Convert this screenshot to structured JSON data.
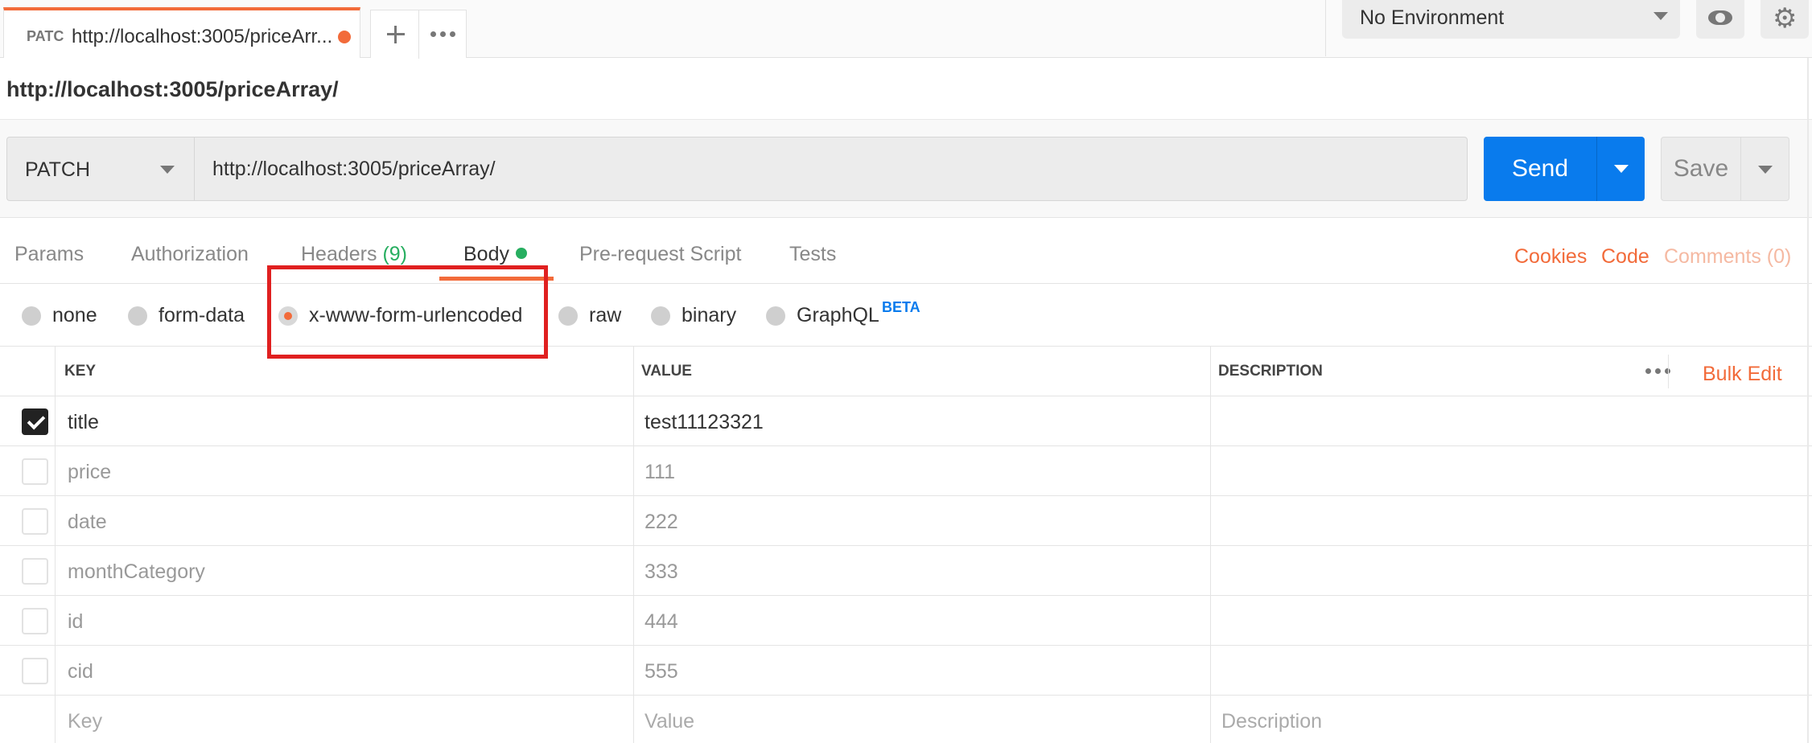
{
  "tab": {
    "method_short": "PATC",
    "title": "http://localhost:3005/priceArr..."
  },
  "environment": {
    "selected": "No Environment"
  },
  "request": {
    "url_title": "http://localhost:3005/priceArray/",
    "method": "PATCH",
    "url": "http://localhost:3005/priceArray/",
    "send_label": "Send",
    "save_label": "Save"
  },
  "subtabs": {
    "params": "Params",
    "authorization": "Authorization",
    "headers": "Headers",
    "headers_count": "(9)",
    "body": "Body",
    "prerequest": "Pre-request Script",
    "tests": "Tests",
    "cookies": "Cookies",
    "code": "Code",
    "comments": "Comments (0)"
  },
  "body_types": {
    "none": "none",
    "form_data": "form-data",
    "urlencoded": "x-www-form-urlencoded",
    "raw": "raw",
    "binary": "binary",
    "graphql": "GraphQL",
    "beta": "BETA",
    "selected": "x-www-form-urlencoded"
  },
  "table": {
    "headers": {
      "key": "KEY",
      "value": "VALUE",
      "description": "DESCRIPTION"
    },
    "bulk_edit": "Bulk Edit",
    "rows": [
      {
        "checked": true,
        "key": "title",
        "value": "test11123321"
      },
      {
        "checked": false,
        "key": "price",
        "value": "111"
      },
      {
        "checked": false,
        "key": "date",
        "value": "222"
      },
      {
        "checked": false,
        "key": "monthCategory",
        "value": "333"
      },
      {
        "checked": false,
        "key": "id",
        "value": "444"
      },
      {
        "checked": false,
        "key": "cid",
        "value": "555"
      }
    ],
    "placeholder": {
      "key": "Key",
      "value": "Value",
      "description": "Description"
    }
  },
  "colors": {
    "accent": "#f26b3a",
    "send": "#097bed",
    "highlight": "#e02020",
    "success": "#27ae60"
  }
}
